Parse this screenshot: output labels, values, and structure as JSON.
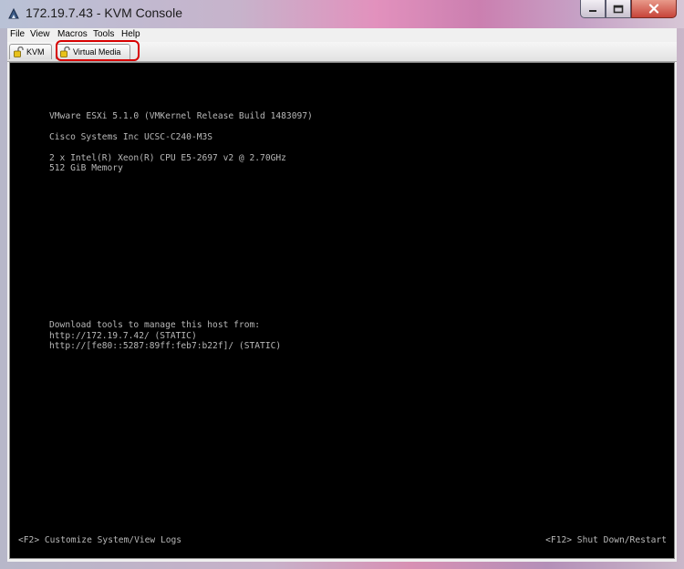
{
  "window": {
    "title": "172.19.7.43 - KVM Console",
    "icon": "java-icon",
    "controls": {
      "minimize_icon": "minimize-icon",
      "maximize_icon": "maximize-icon",
      "close_icon": "close-icon"
    }
  },
  "menubar": {
    "items": [
      "File",
      "View",
      "Macros",
      "Tools",
      "Help"
    ]
  },
  "tabs": [
    {
      "label": "KVM",
      "icon": "lock-open-icon"
    },
    {
      "label": "Virtual Media",
      "icon": "lock-open-icon"
    }
  ],
  "console": {
    "lines": [
      "VMware ESXi 5.1.0 (VMKernel Release Build 1483097)",
      "Cisco Systems Inc UCSC-C240-M3S",
      "2 x Intel(R) Xeon(R) CPU E5-2697 v2 @ 2.70GHz",
      "512 GiB Memory",
      "Download tools to manage this host from:",
      "http://172.19.7.42/ (STATIC)",
      "http://[fe80::5287:89ff:feb7:b22f]/ (STATIC)"
    ],
    "footer_left": "<F2> Customize System/View Logs",
    "footer_right": "<F12> Shut Down/Restart"
  },
  "colors": {
    "highlight_border": "#d80000",
    "console_background": "#000000",
    "console_text": "#b8b8b8"
  }
}
